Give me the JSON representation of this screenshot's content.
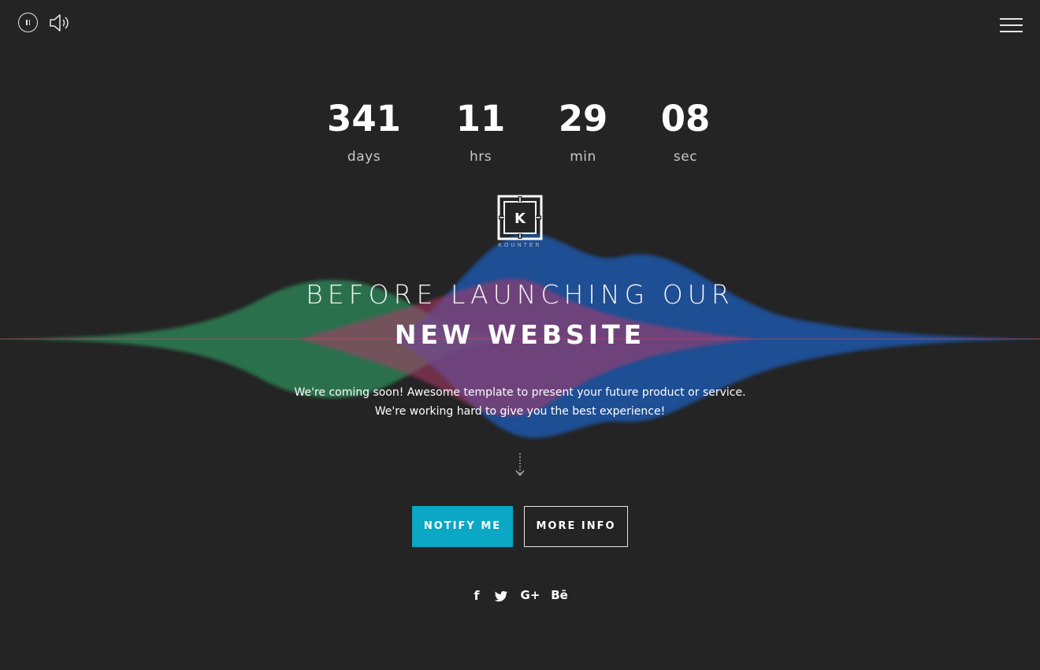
{
  "controls": {
    "pause_icon": "pause-icon",
    "sound_icon": "speaker-icon",
    "menu_icon": "hamburger-menu-icon"
  },
  "countdown": [
    {
      "value": "341",
      "label": "days"
    },
    {
      "value": "11",
      "label": "hrs"
    },
    {
      "value": "29",
      "label": "min"
    },
    {
      "value": "08",
      "label": "sec"
    }
  ],
  "logo": {
    "letter": "K",
    "caption": "KOUNTER"
  },
  "hero": {
    "headline": "BEFORE LAUNCHING OUR",
    "headline_bold": "NEW WEBSITE",
    "description_line1": "We're coming soon! Awesome template to present your future product or service.",
    "description_line2": "We're working hard to give you the best experience!"
  },
  "buttons": {
    "notify_label": "NOTIFY ME",
    "more_info_label": "MORE INFO"
  },
  "social": [
    {
      "name": "facebook-icon",
      "glyph": "f"
    },
    {
      "name": "twitter-icon",
      "glyph": "twitter"
    },
    {
      "name": "google-plus-icon",
      "glyph": "G+"
    },
    {
      "name": "behance-icon",
      "glyph": "Bē"
    }
  ],
  "colors": {
    "background": "#242424",
    "accent": "#0aa8c4",
    "wave_green": "#2f8a5a",
    "wave_blue": "#1f5bb8",
    "wave_pink": "#b03a6a"
  }
}
